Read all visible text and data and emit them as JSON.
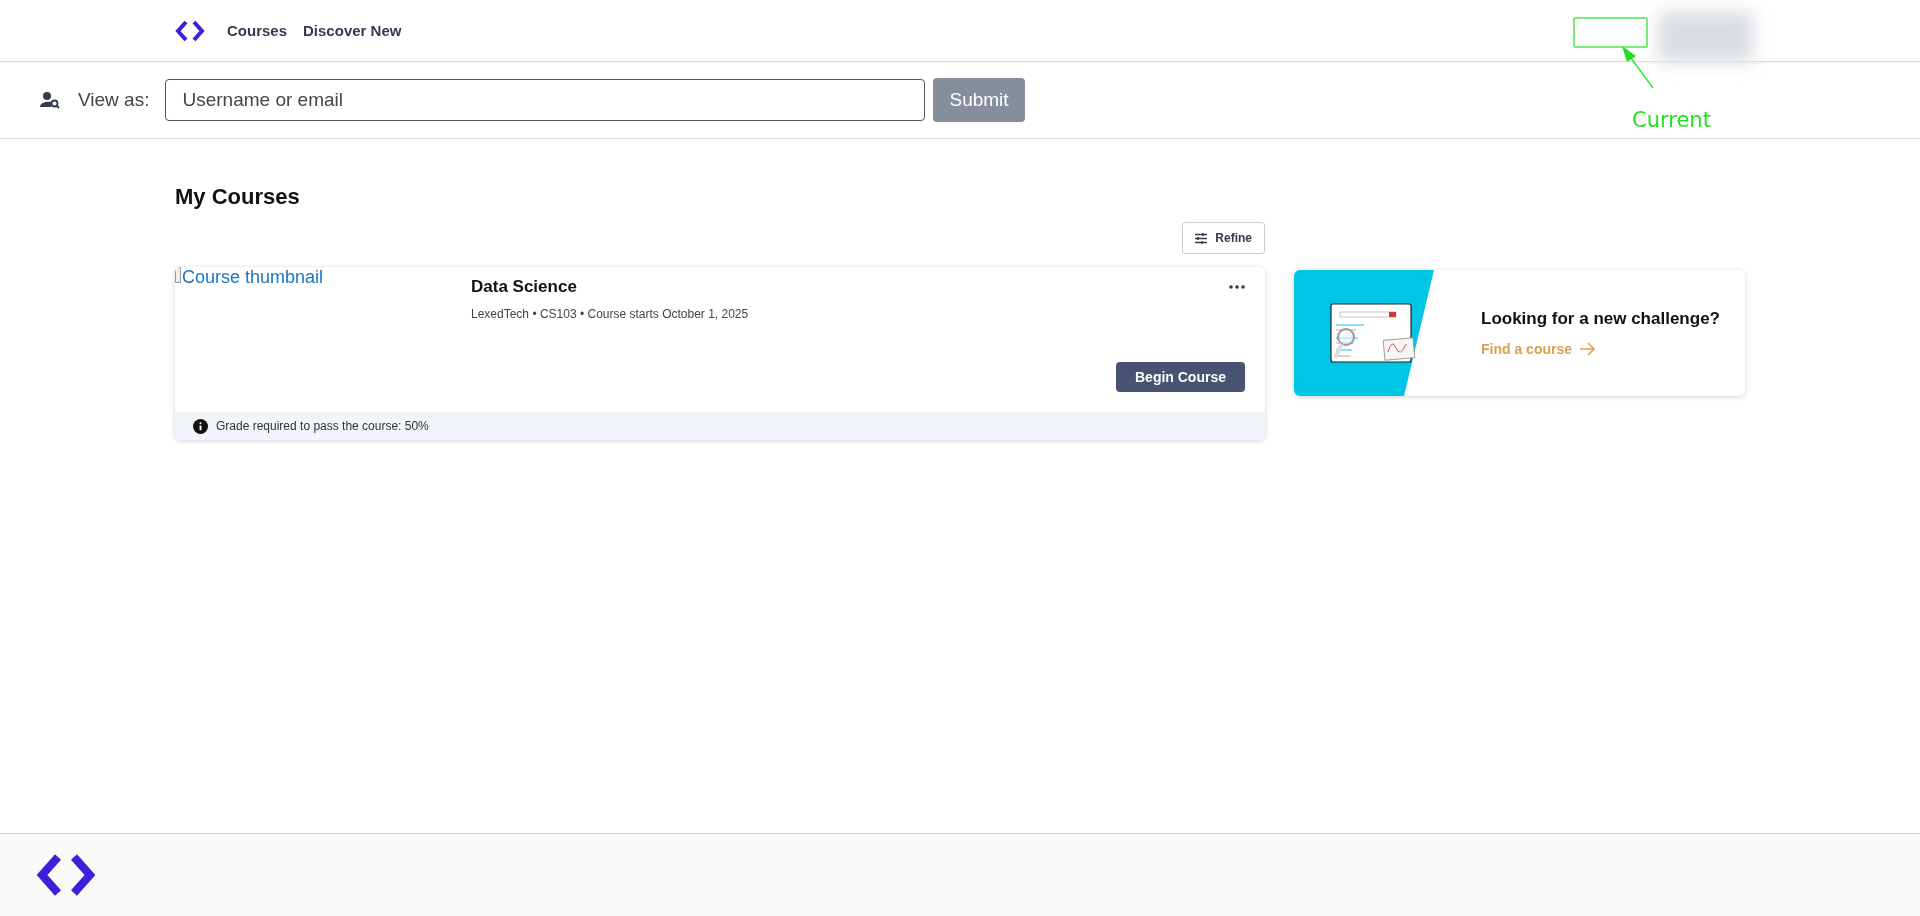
{
  "nav": {
    "links": [
      {
        "label": "Courses"
      },
      {
        "label": "Discover New"
      }
    ]
  },
  "annotation": {
    "label": "Current"
  },
  "view_as": {
    "label": "View as:",
    "placeholder": "Username or email",
    "button": "Submit"
  },
  "page_title": "My Courses",
  "refine_button": "Refine",
  "courses": [
    {
      "thumbnail_alt": "Course thumbnail",
      "title": "Data Science",
      "meta": "LexedTech • CS103 • Course starts October 1, 2025",
      "action": "Begin Course",
      "note": "Grade required to pass the course: 50%"
    }
  ],
  "promo": {
    "title": "Looking for a new challenge?",
    "link": "Find a course"
  }
}
